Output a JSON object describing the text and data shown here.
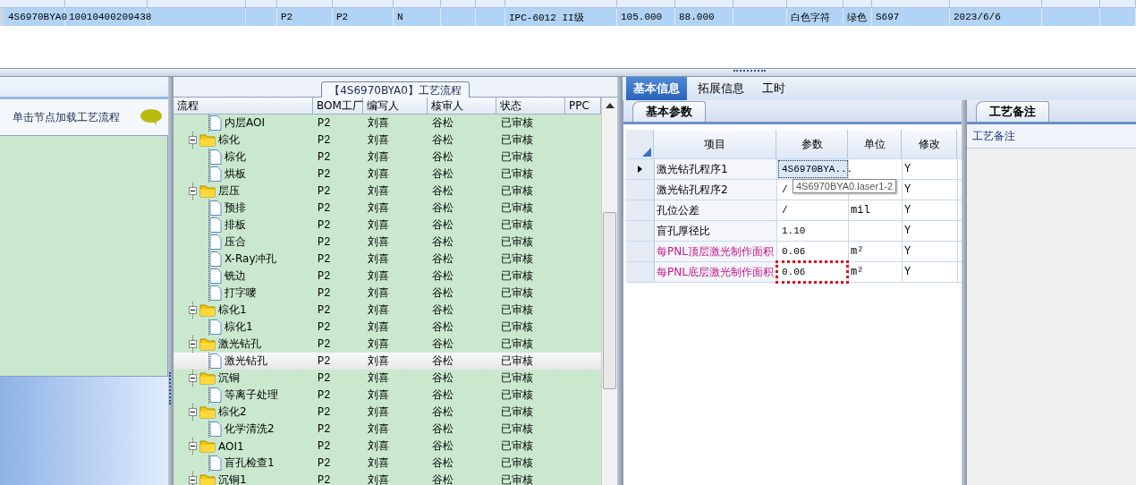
{
  "top_grid": {
    "rows": [
      {
        "selected": true,
        "cells": [
          "4S6970BYA0",
          "10010400209438",
          null,
          null,
          "P2",
          "P2",
          "N",
          null,
          null,
          "IPC-6012 II级",
          "105.000",
          "88.000",
          null,
          "白色字符",
          "绿色",
          "S697",
          "2023/6/6",
          null,
          null
        ]
      }
    ]
  },
  "left_panel": {
    "hint": "单击节点加载工艺流程"
  },
  "flow_panel": {
    "title": "【4S6970BYA0】工艺流程",
    "columns": [
      "流程",
      "BOM工厂",
      "编写人",
      "核审人",
      "状态",
      "PPC"
    ],
    "tree": [
      {
        "children": [
          {
            "name": "内层AOI",
            "bom": "P2",
            "writer": "刘喜",
            "reviewer": "谷松",
            "status": "已审核",
            "selected": false
          }
        ]
      },
      {
        "name": "棕化",
        "bom": "P2",
        "writer": "刘喜",
        "reviewer": "谷松",
        "status": "已审核",
        "selected": false,
        "expanded": true,
        "children": [
          {
            "name": "棕化",
            "bom": "P2",
            "writer": "刘喜",
            "reviewer": "谷松",
            "status": "已审核",
            "selected": false
          },
          {
            "name": "烘板",
            "bom": "P2",
            "writer": "刘喜",
            "reviewer": "谷松",
            "status": "已审核",
            "selected": false
          }
        ]
      },
      {
        "name": "层压",
        "bom": "P2",
        "writer": "刘喜",
        "reviewer": "谷松",
        "status": "已审核",
        "selected": false,
        "expanded": true,
        "children": [
          {
            "name": "预排",
            "bom": "P2",
            "writer": "刘喜",
            "reviewer": "谷松",
            "status": "已审核",
            "selected": false
          },
          {
            "name": "排板",
            "bom": "P2",
            "writer": "刘喜",
            "reviewer": "谷松",
            "status": "已审核",
            "selected": false
          },
          {
            "name": "压合",
            "bom": "P2",
            "writer": "刘喜",
            "reviewer": "谷松",
            "status": "已审核",
            "selected": false
          },
          {
            "name": "X-Ray冲孔",
            "bom": "P2",
            "writer": "刘喜",
            "reviewer": "谷松",
            "status": "已审核",
            "selected": false
          },
          {
            "name": "铣边",
            "bom": "P2",
            "writer": "刘喜",
            "reviewer": "谷松",
            "status": "已审核",
            "selected": false
          },
          {
            "name": "打字嘜",
            "bom": "P2",
            "writer": "刘喜",
            "reviewer": "谷松",
            "status": "已审核",
            "selected": false
          }
        ]
      },
      {
        "name": "棕化1",
        "bom": "P2",
        "writer": "刘喜",
        "reviewer": "谷松",
        "status": "已审核",
        "selected": false,
        "expanded": true,
        "children": [
          {
            "name": "棕化1",
            "bom": "P2",
            "writer": "刘喜",
            "reviewer": "谷松",
            "status": "已审核",
            "selected": false
          }
        ]
      },
      {
        "name": "激光钻孔",
        "bom": "P2",
        "writer": "刘喜",
        "reviewer": "谷松",
        "status": "已审核",
        "selected": false,
        "expanded": true,
        "children": [
          {
            "name": "激光钻孔",
            "bom": "P2",
            "writer": "刘喜",
            "reviewer": "谷松",
            "status": "已审核",
            "selected": true
          }
        ]
      },
      {
        "name": "沉铜",
        "bom": "P2",
        "writer": "刘喜",
        "reviewer": "谷松",
        "status": "已审核",
        "selected": false,
        "expanded": true,
        "children": [
          {
            "name": "等离子处理",
            "bom": "P2",
            "writer": "刘喜",
            "reviewer": "谷松",
            "status": "已审核",
            "selected": false
          }
        ]
      },
      {
        "name": "棕化2",
        "bom": "P2",
        "writer": "刘喜",
        "reviewer": "谷松",
        "status": "已审核",
        "selected": false,
        "expanded": true,
        "children": [
          {
            "name": "化学清洗2",
            "bom": "P2",
            "writer": "刘喜",
            "reviewer": "谷松",
            "status": "已审核",
            "selected": false
          }
        ]
      },
      {
        "name": "AOI1",
        "bom": "P2",
        "writer": "刘喜",
        "reviewer": "谷松",
        "status": "已审核",
        "selected": false,
        "expanded": true,
        "children": [
          {
            "name": "盲孔检查1",
            "bom": "P2",
            "writer": "刘喜",
            "reviewer": "谷松",
            "status": "已审核",
            "selected": false
          }
        ]
      },
      {
        "name": "沉铜1",
        "bom": "P2",
        "writer": "刘喜",
        "reviewer": "谷松",
        "status": "已审核",
        "selected": false,
        "expanded": true
      }
    ]
  },
  "tabs": [
    {
      "label": "基本信息",
      "selected": true
    },
    {
      "label": "拓展信息",
      "selected": false
    },
    {
      "label": "工时",
      "selected": false
    }
  ],
  "params_panel": {
    "tab": "基本参数",
    "columns": [
      "项目",
      "参数",
      "单位",
      "修改"
    ],
    "rows": [
      {
        "item": "激光钻孔程序1",
        "value": "4S6970BYA...",
        "unit": null,
        "modify": "Y",
        "current": true,
        "emphasized": false
      },
      {
        "item": "激光钻孔程序2",
        "value": "/",
        "unit": null,
        "modify": "Y",
        "current": false,
        "emphasized": false
      },
      {
        "item": "孔位公差",
        "value": "/",
        "unit": "mil",
        "modify": "Y",
        "current": false,
        "emphasized": false
      },
      {
        "item": "盲孔厚径比",
        "value": "1.10",
        "unit": null,
        "modify": "Y",
        "current": false,
        "emphasized": false
      },
      {
        "item": "每PNL顶层激光制作面积",
        "value": "0.06",
        "unit": "m²",
        "modify": "Y",
        "current": false,
        "emphasized": true
      },
      {
        "item": "每PNL底层激光制作面积",
        "value": "0.06",
        "unit": "m²",
        "modify": "Y",
        "current": false,
        "emphasized": true
      }
    ],
    "tooltip": "4S6970BYA0.laser1-2"
  },
  "notes_panel": {
    "tab": "工艺备注",
    "label": "工艺备注"
  }
}
